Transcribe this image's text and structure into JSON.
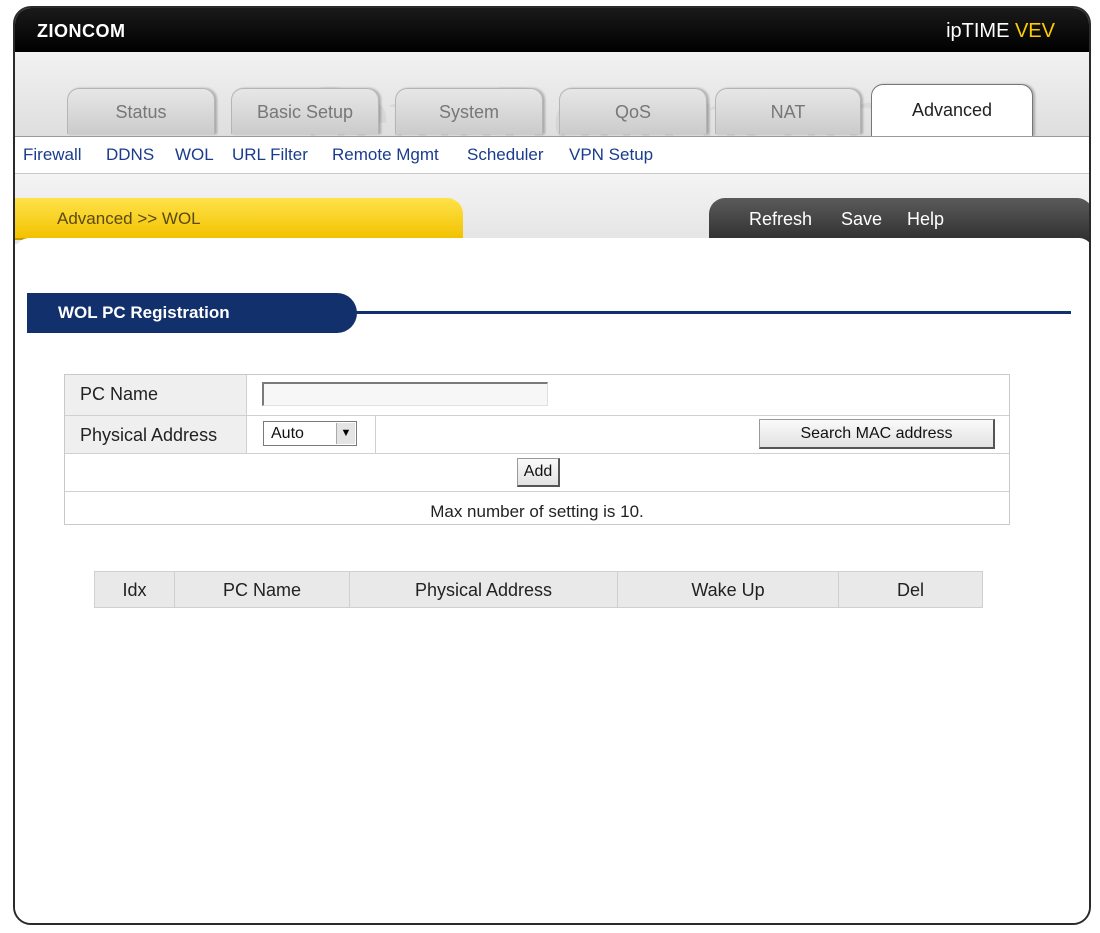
{
  "header": {
    "brand": "ZIONCOM",
    "product_prefix": "ipTIME",
    "product_accent": "VEV",
    "watermark": "SetupRouter.com"
  },
  "main_tabs": [
    {
      "label": "Status"
    },
    {
      "label": "Basic Setup"
    },
    {
      "label": "System"
    },
    {
      "label": "QoS"
    },
    {
      "label": "NAT"
    },
    {
      "label": "Advanced",
      "active": true
    }
  ],
  "sub_nav": [
    {
      "label": "Firewall"
    },
    {
      "label": "DDNS"
    },
    {
      "label": "WOL"
    },
    {
      "label": "URL Filter"
    },
    {
      "label": "Remote Mgmt"
    },
    {
      "label": "Scheduler"
    },
    {
      "label": "VPN Setup"
    }
  ],
  "breadcrumb": "Advanced >> WOL",
  "actions": {
    "refresh": "Refresh",
    "save": "Save",
    "help": "Help"
  },
  "section": {
    "title": "WOL PC Registration"
  },
  "form": {
    "pc_name_label": "PC Name",
    "pc_name_value": "",
    "physical_address_label": "Physical Address",
    "physical_address_selected": "Auto",
    "search_mac_button": "Search MAC address",
    "add_button": "Add",
    "max_note": "Max number of setting is 10."
  },
  "table": {
    "columns": [
      "Idx",
      "PC Name",
      "Physical Address",
      "Wake Up",
      "Del"
    ],
    "rows": []
  },
  "colors": {
    "accent_yellow": "#f2c200",
    "section_navy": "#12306c",
    "link_blue": "#1a3c8c"
  }
}
